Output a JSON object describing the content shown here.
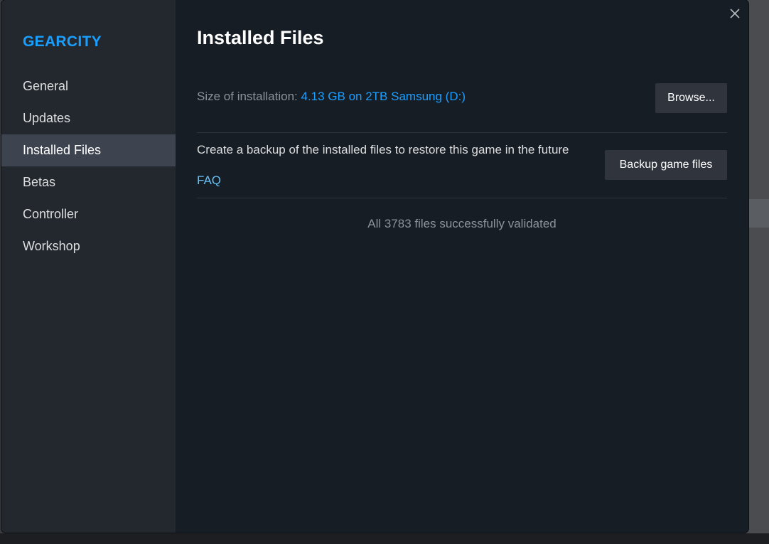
{
  "sidebar": {
    "game_title": "GEARCITY",
    "items": [
      {
        "label": "General"
      },
      {
        "label": "Updates"
      },
      {
        "label": "Installed Files"
      },
      {
        "label": "Betas"
      },
      {
        "label": "Controller"
      },
      {
        "label": "Workshop"
      }
    ],
    "active_index": 2
  },
  "main": {
    "title": "Installed Files",
    "size_label": "Size of installation:",
    "size_value": "4.13 GB on 2TB Samsung (D:)",
    "browse_label": "Browse...",
    "backup_text": "Create a backup of the installed files to restore this game in the future",
    "faq_label": "FAQ",
    "backup_button_label": "Backup game files",
    "validation_status": "All 3783 files successfully validated"
  },
  "icons": {
    "close": "close-icon"
  },
  "colors": {
    "accent": "#1a9fff",
    "link": "#66c0f4",
    "background": "#171d25",
    "sidebar": "#23272e",
    "active_item": "#3d4450"
  }
}
